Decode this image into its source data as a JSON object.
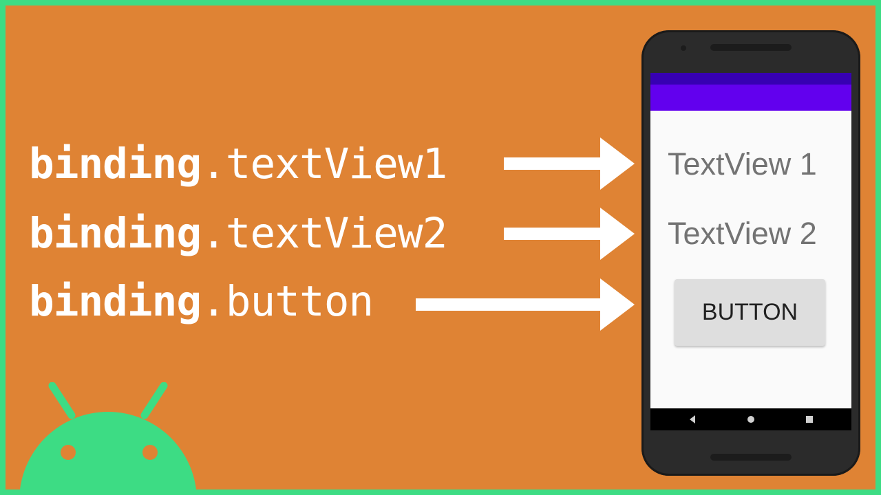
{
  "code_lines": [
    {
      "object": "binding",
      "property": ".textView1"
    },
    {
      "object": "binding",
      "property": ".textView2"
    },
    {
      "object": "binding",
      "property": ".button"
    }
  ],
  "phone": {
    "textview1": "TextView 1",
    "textview2": "TextView 2",
    "button_label": "BUTTON"
  },
  "colors": {
    "background": "#df8334",
    "border": "#3ddc84",
    "android_logo": "#3ddc84",
    "status_bar": "#3700b3",
    "app_bar": "#6200ee"
  },
  "icons": [
    "android-logo-icon",
    "arrow-right-icon",
    "nav-back-icon",
    "nav-home-icon",
    "nav-recents-icon"
  ]
}
